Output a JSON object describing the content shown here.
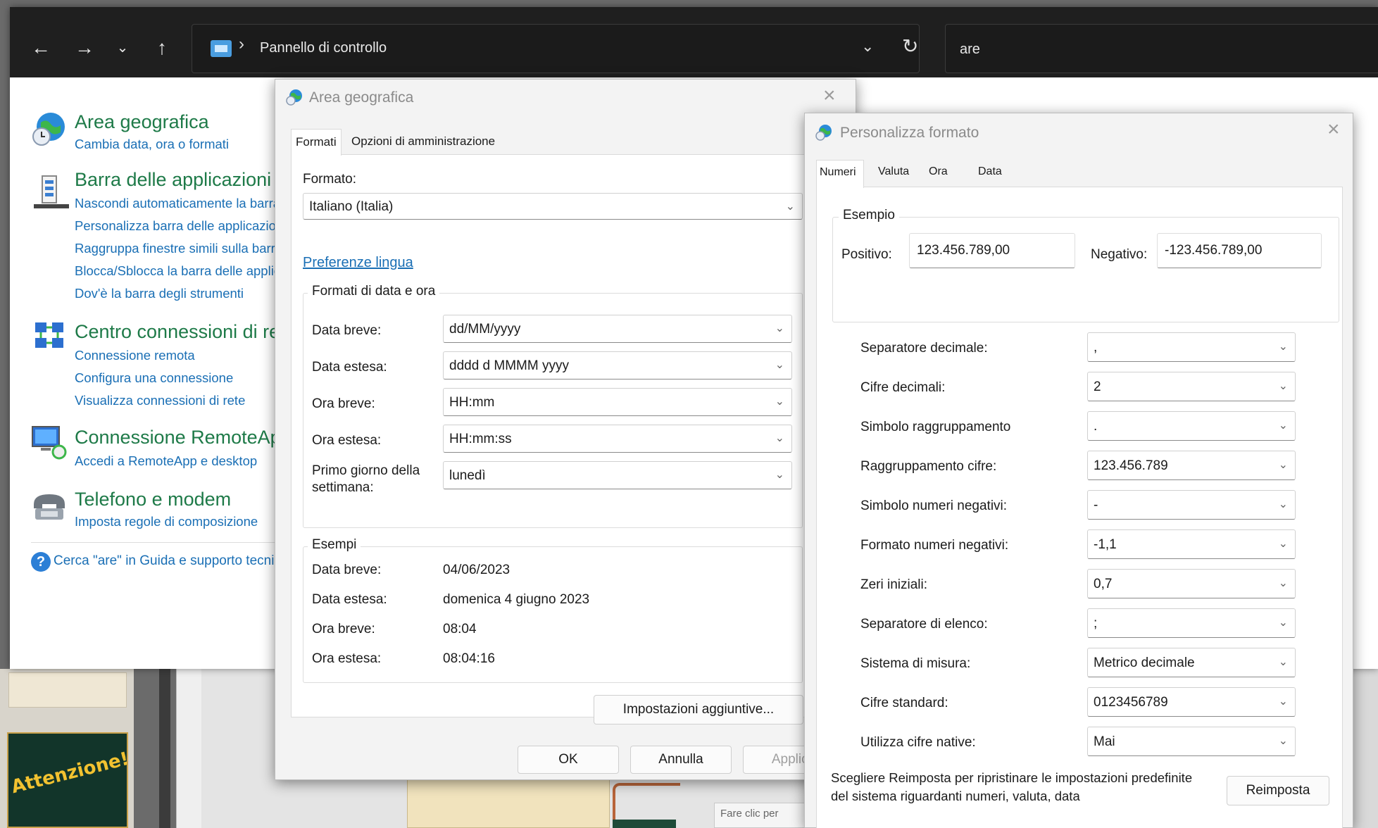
{
  "explorer": {
    "address_separator": "›",
    "breadcrumb": "Pannello di controllo",
    "search_value": "are",
    "categories": [
      {
        "title": "Area geografica",
        "links": [
          "Cambia data, ora o formati"
        ]
      },
      {
        "title": "Barra delle applicazioni",
        "links": [
          "Nascondi automaticamente la barra",
          "Personalizza barra delle applicazioni",
          "Raggruppa finestre simili sulla barra",
          "Blocca/Sblocca la barra delle applicazioni",
          "Dov'è la barra degli strumenti"
        ]
      },
      {
        "title": "Centro connessioni di rete",
        "links": [
          "Connessione remota",
          "Configura una connessione",
          "Visualizza connessioni di rete"
        ]
      },
      {
        "title": "Connessione RemoteApp",
        "links": [
          "Accedi a RemoteApp e desktop"
        ]
      },
      {
        "title": "Telefono e modem",
        "links": [
          "Imposta regole di composizione"
        ]
      }
    ],
    "help_text": "Cerca \"are\" in Guida e supporto tecnico"
  },
  "region_dialog": {
    "title": "Area geografica",
    "tabs": [
      "Formati",
      "Opzioni di amministrazione"
    ],
    "format_label": "Formato:",
    "format_value": "Italiano (Italia)",
    "language_prefs_link": "Preferenze lingua",
    "datetime_group_title": "Formati di data e ora",
    "rows": [
      {
        "label": "Data breve:",
        "value": "dd/MM/yyyy"
      },
      {
        "label": "Data estesa:",
        "value": "dddd d MMMM yyyy"
      },
      {
        "label": "Ora breve:",
        "value": "HH:mm"
      },
      {
        "label": "Ora estesa:",
        "value": "HH:mm:ss"
      },
      {
        "label": "Primo giorno della settimana:",
        "value": "lunedì"
      }
    ],
    "examples_group_title": "Esempi",
    "examples": [
      {
        "label": "Data breve:",
        "value": "04/06/2023"
      },
      {
        "label": "Data estesa:",
        "value": "domenica 4 giugno 2023"
      },
      {
        "label": "Ora breve:",
        "value": "08:04"
      },
      {
        "label": "Ora estesa:",
        "value": "08:04:16"
      }
    ],
    "additional_settings_button": "Impostazioni aggiuntive...",
    "ok_button": "OK",
    "cancel_button": "Annulla",
    "apply_button": "Applica"
  },
  "customize_dialog": {
    "title": "Personalizza formato",
    "tabs": [
      "Numeri",
      "Valuta",
      "Ora",
      "Data"
    ],
    "example_group_title": "Esempio",
    "positive_label": "Positivo:",
    "positive_value": "123.456.789,00",
    "negative_label": "Negativo:",
    "negative_value": "-123.456.789,00",
    "settings": [
      {
        "label": "Separatore decimale:",
        "value": ","
      },
      {
        "label": "Cifre decimali:",
        "value": "2"
      },
      {
        "label": "Simbolo raggruppamento",
        "value": "."
      },
      {
        "label": "Raggruppamento cifre:",
        "value": "123.456.789"
      },
      {
        "label": "Simbolo numeri negativi:",
        "value": "-"
      },
      {
        "label": "Formato numeri negativi:",
        "value": "-1,1"
      },
      {
        "label": "Zeri iniziali:",
        "value": "0,7"
      },
      {
        "label": "Separatore di elenco:",
        "value": ";"
      },
      {
        "label": "Sistema di misura:",
        "value": "Metrico decimale"
      },
      {
        "label": "Cifre standard:",
        "value": "0123456789"
      },
      {
        "label": "Utilizza cifre native:",
        "value": "Mai"
      }
    ],
    "reset_text": "Scegliere Reimposta per ripristinare le impostazioni predefinite del sistema riguardanti numeri, valuta, data",
    "reset_button": "Reimposta"
  },
  "background": {
    "slide_title": "Attenzione!",
    "bubble_text": "Fare clic per"
  },
  "colors": {
    "link": "#1a6fb5",
    "category_title": "#1e7a48",
    "titlebar": "#1f1f1f"
  }
}
